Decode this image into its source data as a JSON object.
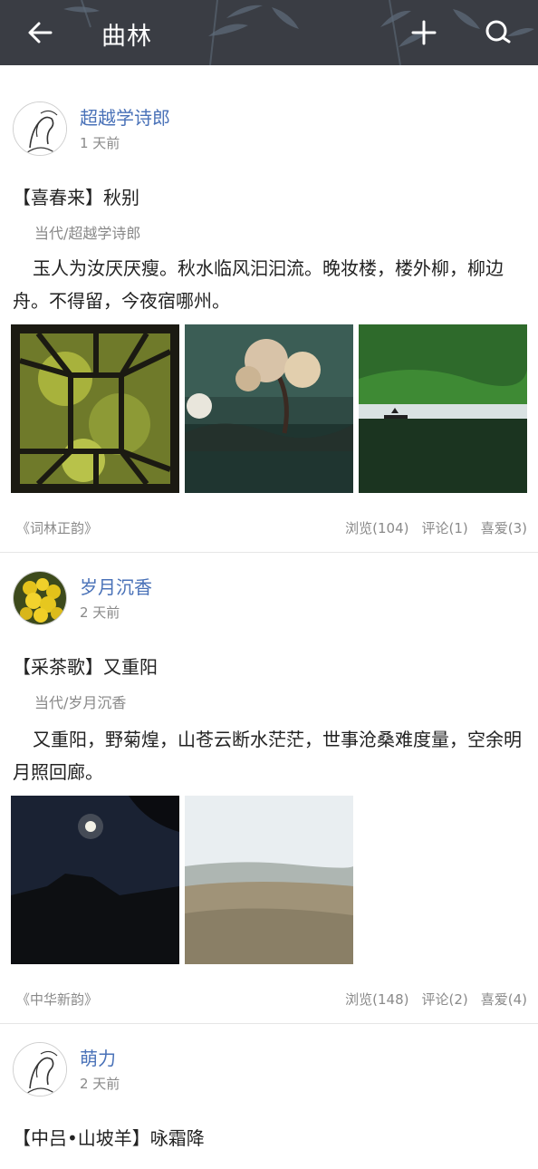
{
  "header": {
    "title": "曲林",
    "back_icon": "arrow-left-icon",
    "add_icon": "plus-icon",
    "search_icon": "search-icon",
    "bg_color": "#3a3d44"
  },
  "posts": [
    {
      "author": "超越学诗郎",
      "time": "1 天前",
      "title": "【喜春来】秋别",
      "sub": "当代/超越学诗郎",
      "body": "玉人为汝厌厌瘦。秋水临风汩汩流。晚妆楼，楼外柳，柳边舟。不得留，今夜宿哪州。",
      "source": "《词林正韵》",
      "views": "浏览(104)",
      "comments": "评论(1)",
      "likes": "喜爱(3)"
    },
    {
      "author": "岁月沉香",
      "time": "2 天前",
      "title": "【采茶歌】又重阳",
      "sub": "当代/岁月沉香",
      "body": "又重阳，野菊煌，山苍云断水茫茫，世事沧桑难度量，空余明月照回廊。",
      "source": "《中华新韵》",
      "views": "浏览(148)",
      "comments": "评论(2)",
      "likes": "喜爱(4)"
    },
    {
      "author": "萌力",
      "time": "2 天前",
      "title": "【中吕•山坡羊】咏霜降"
    }
  ],
  "colors": {
    "author_link": "#4a72b8",
    "meta_gray": "#8a8a8a"
  }
}
